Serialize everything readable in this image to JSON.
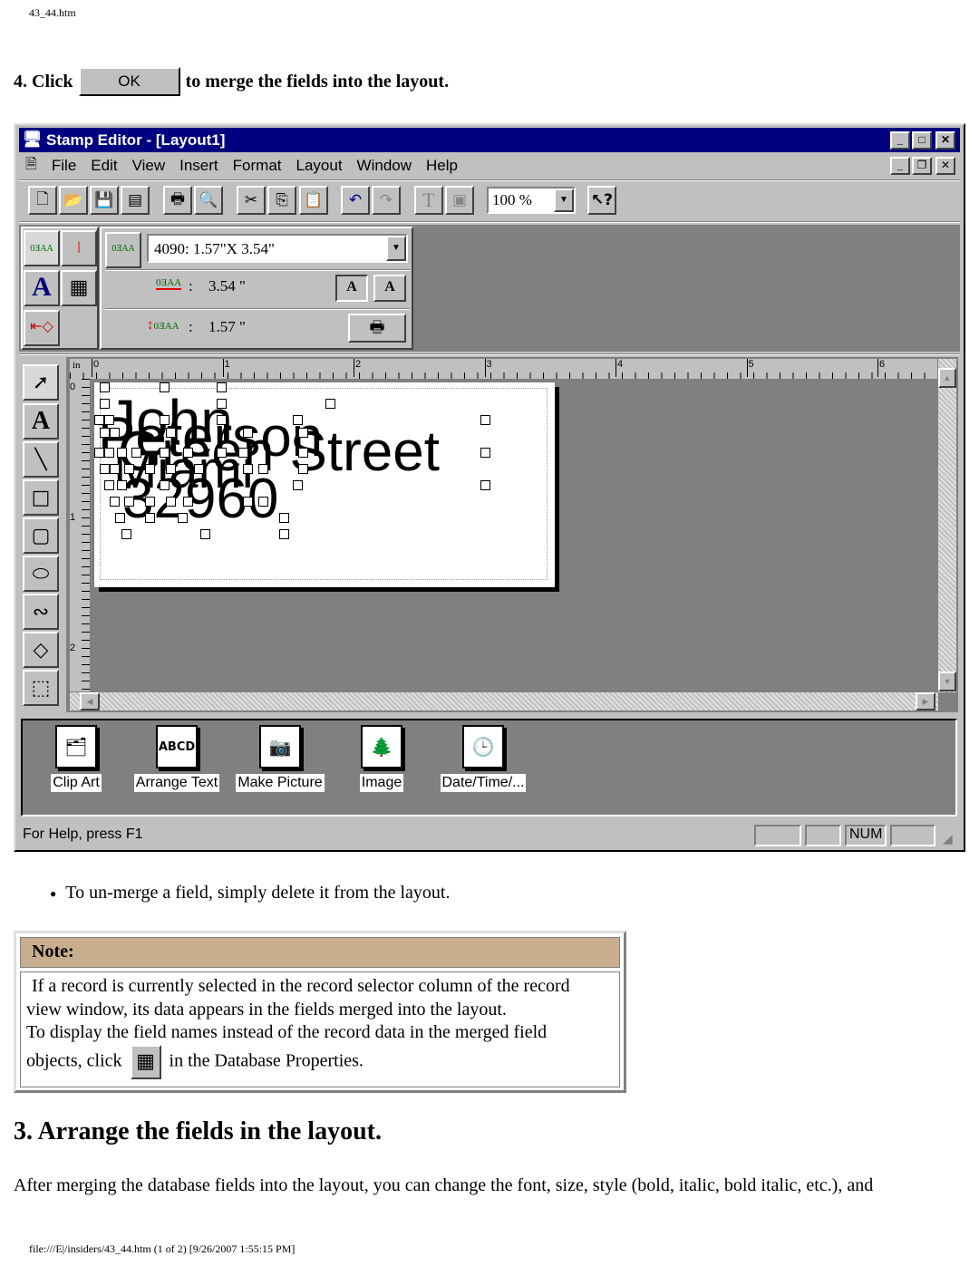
{
  "header": {
    "filename": "43_44.htm"
  },
  "step4": {
    "prefix": "4. Click",
    "ok_label": "OK",
    "suffix": "to merge the fields into the layout."
  },
  "app": {
    "title": "Stamp Editor - [Layout1]",
    "menu": [
      "File",
      "Edit",
      "View",
      "Insert",
      "Format",
      "Layout",
      "Window",
      "Help"
    ],
    "zoom_value": "100 %",
    "stamp_size": "4090: 1.57\"X 3.54\"",
    "width_label": ":",
    "width_value": "3.54 \"",
    "height_label": ":",
    "height_value": "1.57 \"",
    "ruler_unit": "in",
    "ruler_h": [
      "0",
      "1",
      "2",
      "3",
      "4",
      "5",
      "6"
    ],
    "ruler_v": [
      "0",
      "1",
      "2"
    ],
    "layout_fields": [
      "John",
      "Peterson",
      "Green Street",
      "Miami",
      "32960"
    ],
    "palette": [
      "Clip Art",
      "Arrange Text",
      "Make Picture",
      "Image",
      "Date/Time/..."
    ],
    "status": {
      "help": "For Help, press F1",
      "num": "NUM"
    },
    "colors": {
      "titlebar": "#000080",
      "face": "#c0c0c0",
      "workspace": "#808080"
    }
  },
  "bullet": "To un-merge a field, simply delete it from the layout.",
  "note": {
    "title": "Note:",
    "line1": "If a record is currently selected in the record selector column of the record view window, its data appears in the fields merged into the layout.",
    "line2a": "To display the field names instead of the record data in the merged field objects, click",
    "line2b": "in the Database Properties."
  },
  "section": {
    "heading": "3. Arrange the fields in the layout.",
    "paragraph": "After merging the database fields into the layout, you can change the font, size, style (bold, italic, bold italic, etc.), and"
  },
  "footer": "file:///E|/insiders/43_44.htm (1 of 2) [9/26/2007 1:55:15 PM]"
}
